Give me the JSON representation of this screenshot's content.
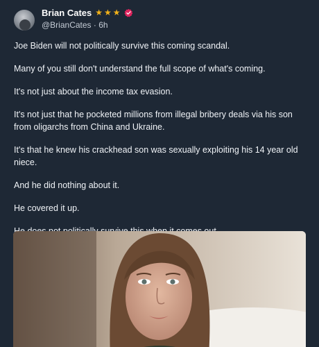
{
  "post": {
    "author": {
      "display_name": "Brian Cates",
      "handle": "@BrianCates",
      "separator": "·",
      "time_ago": "6h",
      "badges": [
        "star-icon",
        "star-icon",
        "star-icon",
        "verified-badge-icon"
      ]
    },
    "paragraphs": [
      "Joe Biden will not politically survive this coming scandal.",
      "Many of you still don't understand the full scope of what's coming.",
      "It's not just about the income tax evasion.",
      "It's not just that he pocketed millions from illegal bribery deals via his son from oligarchs from China and Ukraine.",
      "It's that he knew his crackhead son was sexually exploiting his 14 year old niece.",
      "And he did nothing about it.",
      "He covered it up.",
      " He does not politically survive this when it comes out."
    ],
    "media": {
      "kind": "image"
    }
  },
  "colors": {
    "background": "#1e2835",
    "star": "#f3b21a",
    "verified": "#e0245e"
  }
}
